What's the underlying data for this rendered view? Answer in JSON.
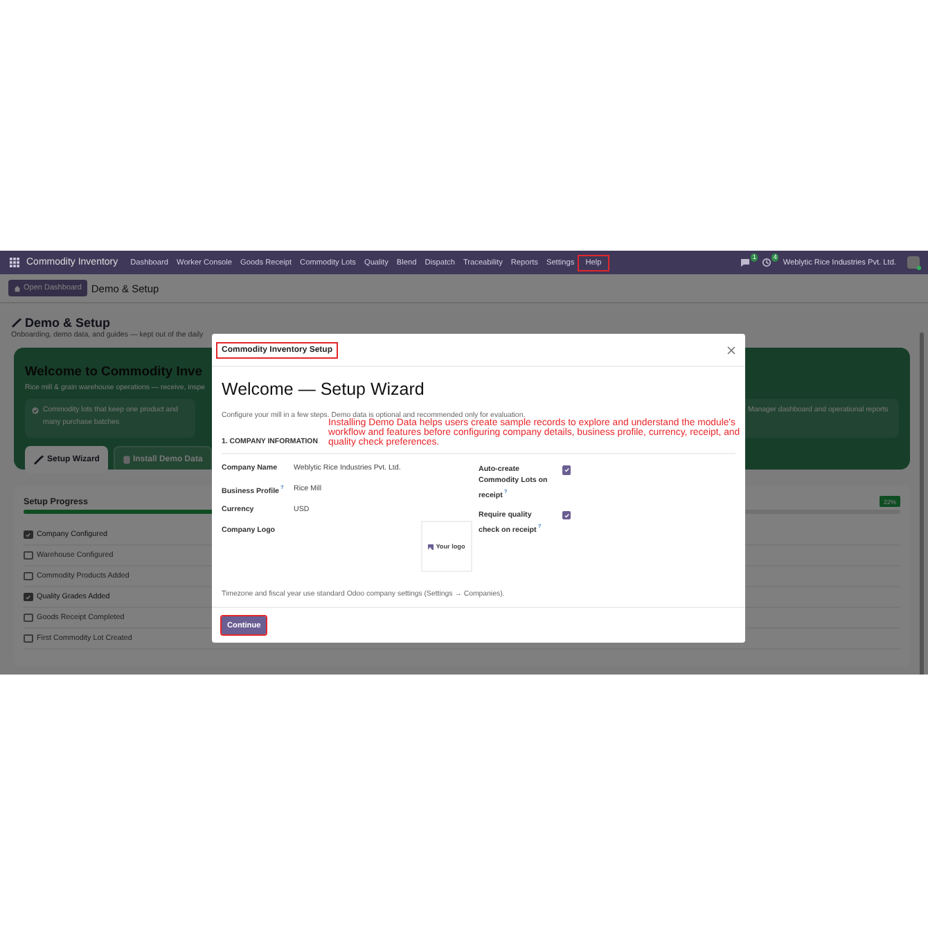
{
  "navbar": {
    "app_name": "Commodity Inventory",
    "menu": [
      {
        "label": "Dashboard",
        "highlighted": false
      },
      {
        "label": "Worker Console",
        "highlighted": false
      },
      {
        "label": "Goods Receipt",
        "highlighted": false
      },
      {
        "label": "Commodity Lots",
        "highlighted": false
      },
      {
        "label": "Quality",
        "highlighted": false
      },
      {
        "label": "Blend",
        "highlighted": false
      },
      {
        "label": "Dispatch",
        "highlighted": false
      },
      {
        "label": "Traceability",
        "highlighted": false
      },
      {
        "label": "Reports",
        "highlighted": false
      },
      {
        "label": "Settings",
        "highlighted": false
      },
      {
        "label": "Help",
        "highlighted": true
      }
    ],
    "chat_badge": "1",
    "activity_badge": "4",
    "company": "Weblytic Rice Industries Pvt. Ltd."
  },
  "breadcrumb": {
    "button": "Open Dashboard",
    "current": "Demo & Setup"
  },
  "page": {
    "title": "Demo & Setup",
    "subtitle": "Onboarding, demo data, and guides — kept out of the daily"
  },
  "welcome_card": {
    "title": "Welcome to Commodity Inve",
    "subtitle": "Rice mill & grain warehouse operations — receive, inspe",
    "features": [
      "Commodity lots that keep one product and many purchase batches",
      "Manager dashboard and operational reports"
    ],
    "buttons": [
      {
        "label": "Setup Wizard",
        "kind": "primary"
      },
      {
        "label": "Install Demo Data",
        "kind": "secondary"
      }
    ]
  },
  "setup_progress": {
    "title": "Setup Progress",
    "level": 0.22,
    "percent": "22%",
    "steps": [
      {
        "label": "Company Configured",
        "checked": true
      },
      {
        "label": "Warehouse Configured",
        "checked": false
      },
      {
        "label": "Commodity Products Added",
        "checked": false
      },
      {
        "label": "Quality Grades Added",
        "checked": true
      },
      {
        "label": "Goods Receipt Completed",
        "checked": false
      },
      {
        "label": "First Commodity Lot Created",
        "checked": false
      }
    ]
  },
  "modal": {
    "header": "Commodity Inventory Setup",
    "header_highlighted": true,
    "title": "Welcome — Setup Wizard",
    "intro": "Configure your mill in a few steps. Demo data is optional and recommended only for evaluation.",
    "section": "1. COMPANY INFORMATION",
    "fields": [
      {
        "label": "Company Name",
        "value": "Weblytic Rice Industries Pvt. Ltd."
      },
      {
        "label": "Business Profile$^{?}$",
        "value": "Rice Mill"
      },
      {
        "label": "Currency",
        "value": "USD"
      }
    ],
    "logo": {
      "label": "Company Logo",
      "placeholder": "Your logo"
    },
    "options": [
      {
        "label": "Auto-create Commodity Lots on receipt$^{?}$",
        "checked": true
      },
      {
        "label": "Require quality check on receipt$^{?}$",
        "checked": true
      }
    ],
    "note": "Timezone and fiscal year use standard Odoo company settings (Settings → Companies).",
    "continue": {
      "label": "Continue",
      "highlighted": true
    }
  },
  "annotation": "Installing Demo Data helps users create sample records to explore and understand the module's workflow and features before configuring company details, business profile, currency, receipt, and quality check preferences."
}
